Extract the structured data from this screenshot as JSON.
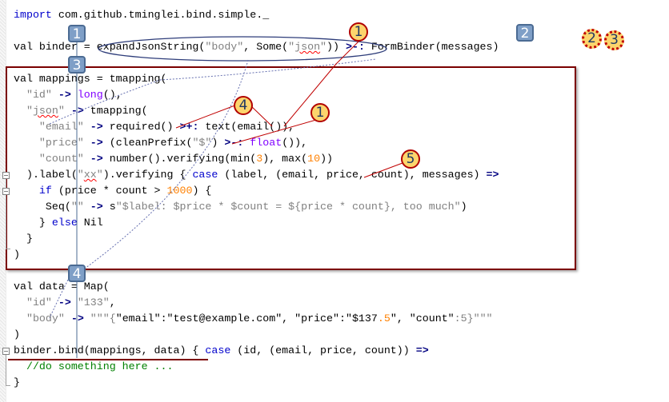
{
  "editor": {
    "lines": [
      {
        "tokens": [
          [
            "kw",
            "import"
          ],
          [
            "plain",
            " com.github.tminglei.bind.simple._"
          ]
        ]
      },
      {
        "tokens": []
      },
      {
        "tokens": [
          [
            "plain",
            "val binder = expandJsonString("
          ],
          [
            "str",
            "\"body\""
          ],
          [
            "plain",
            ", Some("
          ],
          [
            "str",
            "\""
          ],
          [
            "sq",
            "json"
          ],
          [
            "str",
            "\""
          ],
          [
            "plain",
            "))"
          ],
          [
            "op",
            " >-:"
          ],
          [
            "plain",
            " FormBinder(messages)"
          ]
        ]
      },
      {
        "tokens": []
      },
      {
        "tokens": [
          [
            "plain",
            "val mappings = tmapping("
          ]
        ]
      },
      {
        "tokens": [
          [
            "plain",
            "  "
          ],
          [
            "str",
            "\"id\""
          ],
          [
            "op",
            " ->"
          ],
          [
            "fn",
            " long"
          ],
          [
            "plain",
            "(),"
          ]
        ]
      },
      {
        "tokens": [
          [
            "plain",
            "  "
          ],
          [
            "str",
            "\""
          ],
          [
            "sq",
            "json"
          ],
          [
            "str",
            "\""
          ],
          [
            "op",
            " ->"
          ],
          [
            "plain",
            " tmapping("
          ]
        ]
      },
      {
        "tokens": [
          [
            "plain",
            "    "
          ],
          [
            "str",
            "\"email\""
          ],
          [
            "op",
            " ->"
          ],
          [
            "plain",
            " required()"
          ],
          [
            "op",
            " >+:"
          ],
          [
            "plain",
            " text(email()),"
          ]
        ]
      },
      {
        "tokens": [
          [
            "plain",
            "    "
          ],
          [
            "str",
            "\"price\""
          ],
          [
            "op",
            " ->"
          ],
          [
            "plain",
            " (cleanPrefix("
          ],
          [
            "str",
            "\"$\""
          ],
          [
            "plain",
            ")"
          ],
          [
            "op",
            " >-:"
          ],
          [
            "fn",
            " float"
          ],
          [
            "plain",
            "()),"
          ]
        ]
      },
      {
        "tokens": [
          [
            "plain",
            "    "
          ],
          [
            "str",
            "\"count\""
          ],
          [
            "op",
            " ->"
          ],
          [
            "plain",
            " number().verifying(min("
          ],
          [
            "num",
            "3"
          ],
          [
            "plain",
            "), max("
          ],
          [
            "num",
            "10"
          ],
          [
            "plain",
            "))"
          ]
        ]
      },
      {
        "tokens": [
          [
            "plain",
            "  ).label("
          ],
          [
            "str",
            "\""
          ],
          [
            "sq",
            "xx"
          ],
          [
            "str",
            "\""
          ],
          [
            "plain",
            ").verifying { "
          ],
          [
            "kw",
            "case"
          ],
          [
            "plain",
            " (label, (email, price, count), messages)"
          ],
          [
            "op",
            " =>"
          ]
        ]
      },
      {
        "tokens": [
          [
            "plain",
            "    "
          ],
          [
            "kw",
            "if"
          ],
          [
            "plain",
            " (price * count > "
          ],
          [
            "num",
            "1000"
          ],
          [
            "plain",
            ") {"
          ]
        ]
      },
      {
        "tokens": [
          [
            "plain",
            "     Seq("
          ],
          [
            "str",
            "\"\""
          ],
          [
            "op",
            " ->"
          ],
          [
            "plain",
            " s"
          ],
          [
            "str",
            "\"$label: $price * $count = ${price * count}, too much\""
          ],
          [
            "plain",
            ")"
          ]
        ]
      },
      {
        "tokens": [
          [
            "plain",
            "    } "
          ],
          [
            "kw",
            "else"
          ],
          [
            "plain",
            " Nil"
          ]
        ]
      },
      {
        "tokens": [
          [
            "plain",
            "  }"
          ]
        ]
      },
      {
        "tokens": [
          [
            "plain",
            ")"
          ]
        ]
      },
      {
        "tokens": []
      },
      {
        "tokens": [
          [
            "plain",
            "val data = Map("
          ]
        ]
      },
      {
        "tokens": [
          [
            "plain",
            "  "
          ],
          [
            "str",
            "\"id\""
          ],
          [
            "op",
            " ->"
          ],
          [
            "str",
            " \"133\""
          ],
          [
            "plain",
            ","
          ]
        ]
      },
      {
        "tokens": [
          [
            "plain",
            "  "
          ],
          [
            "str",
            "\"body\""
          ],
          [
            "op",
            " ->"
          ],
          [
            "str",
            " \"\"\"{"
          ],
          [
            "plain",
            "\"email\":\"test@example.com\", \"price\":\"$137"
          ],
          [
            "num",
            ".5"
          ],
          [
            "plain",
            "\", \"count\""
          ],
          [
            "str",
            ":5}\"\"\""
          ]
        ]
      },
      {
        "tokens": [
          [
            "plain",
            ")"
          ]
        ]
      },
      {
        "tokens": [
          [
            "plain",
            "binder.bind(mappings, data) { "
          ],
          [
            "kw",
            "case"
          ],
          [
            "plain",
            " (id, (email, price, count))"
          ],
          [
            "op",
            " =>"
          ]
        ]
      },
      {
        "tokens": [
          [
            "cm",
            "  //do something here ..."
          ]
        ]
      },
      {
        "tokens": [
          [
            "plain",
            "}"
          ]
        ]
      }
    ]
  },
  "annotations": {
    "square_badges": [
      "1",
      "3",
      "2",
      "4"
    ],
    "circle_badges": [
      "1",
      "4",
      "1",
      "5"
    ],
    "dotted_badges": [
      "2",
      "3"
    ]
  },
  "colors": {
    "keyword": "#0000cc",
    "string": "#808080",
    "number": "#ff8000",
    "function": "#8000ff",
    "operator": "#000080",
    "comment": "#008000",
    "highlight_box": "#7b0000",
    "badge_blue": "#7f9fc7",
    "badge_yellow": "#fcd56d",
    "annotation_red": "#b10000"
  }
}
